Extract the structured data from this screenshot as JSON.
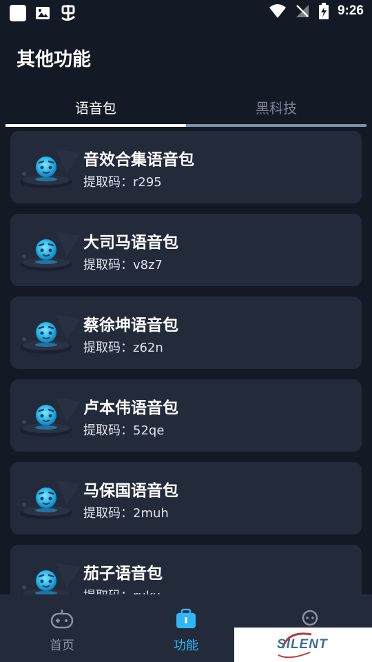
{
  "status_bar": {
    "time": "9:26"
  },
  "page": {
    "title": "其他功能"
  },
  "tabs": [
    {
      "label": "语音包"
    },
    {
      "label": "黑科技"
    }
  ],
  "items": [
    {
      "title": "音效合集语音包",
      "code": "提取码：r295"
    },
    {
      "title": "大司马语音包",
      "code": "提取码：v8z7"
    },
    {
      "title": "蔡徐坤语音包",
      "code": "提取码：z62n"
    },
    {
      "title": "卢本伟语音包",
      "code": "提取码：52qe"
    },
    {
      "title": "马保国语音包",
      "code": "提取码：2muh"
    },
    {
      "title": "茄子语音包",
      "code": "提取码：ruku"
    }
  ],
  "nav": [
    {
      "label": "首页"
    },
    {
      "label": "功能"
    },
    {
      "label": ""
    }
  ],
  "watermark": {
    "text": "SILENT"
  },
  "colors": {
    "background": "#141a25",
    "card": "#232a3a",
    "accent": "#2fb7f5",
    "tab_inactive_line": "#7e92ac"
  }
}
